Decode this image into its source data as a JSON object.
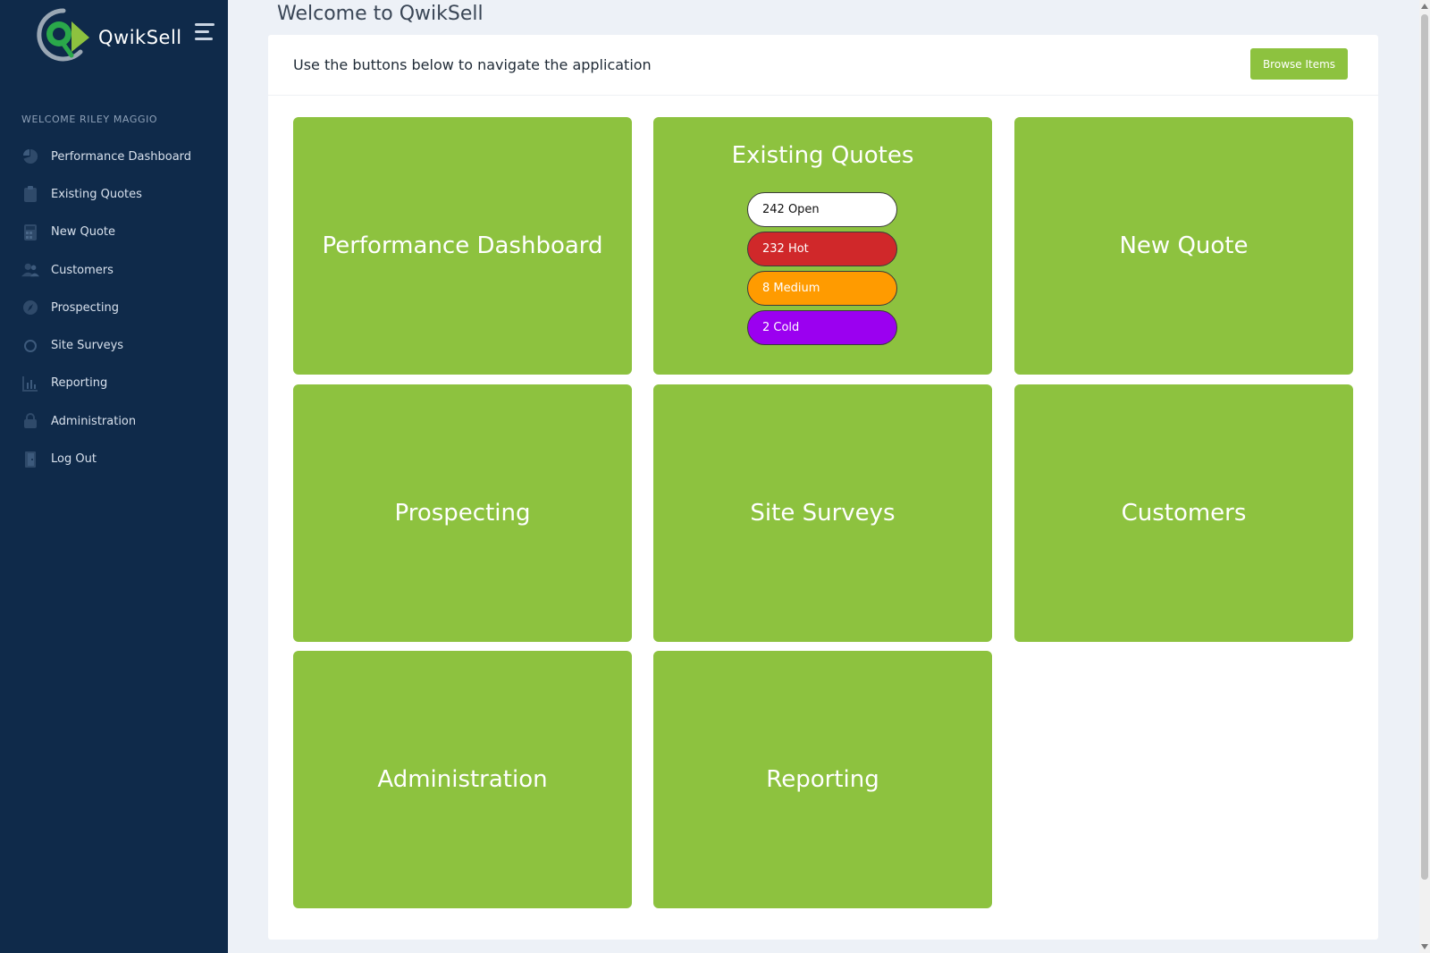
{
  "app": {
    "brand_name": "QwikSell",
    "page_title": "Welcome to QwikSell"
  },
  "sidebar": {
    "welcome_label": "WELCOME RILEY MAGGIO",
    "items": [
      {
        "label": "Performance Dashboard",
        "icon": "pie-chart-icon"
      },
      {
        "label": "Existing Quotes",
        "icon": "clipboard-icon"
      },
      {
        "label": "New Quote",
        "icon": "calculator-icon"
      },
      {
        "label": "Customers",
        "icon": "users-icon"
      },
      {
        "label": "Prospecting",
        "icon": "compass-icon"
      },
      {
        "label": "Site Surveys",
        "icon": "circle-icon"
      },
      {
        "label": "Reporting",
        "icon": "bar-chart-icon"
      },
      {
        "label": "Administration",
        "icon": "lock-icon"
      },
      {
        "label": "Log Out",
        "icon": "door-icon"
      }
    ]
  },
  "panel": {
    "instructions": "Use the buttons below to navigate the application",
    "browse_button": "Browse Items"
  },
  "tiles": {
    "performance_dashboard": "Performance Dashboard",
    "existing_quotes": "Existing Quotes",
    "new_quote": "New Quote",
    "prospecting": "Prospecting",
    "site_surveys": "Site Surveys",
    "customers": "Customers",
    "administration": "Administration",
    "reporting": "Reporting"
  },
  "quote_status": [
    {
      "label": "242 Open",
      "color": "#ffffff",
      "text_color": "#111111"
    },
    {
      "label": "232 Hot",
      "color": "#d0282a",
      "text_color": "#ffffff"
    },
    {
      "label": "8 Medium",
      "color": "#ff9b00",
      "text_color": "#ffffff"
    },
    {
      "label": "2 Cold",
      "color": "#9b00f0",
      "text_color": "#ffffff"
    }
  ],
  "colors": {
    "sidebar_bg": "#0f2a4a",
    "accent_green": "#8dc23f",
    "page_bg": "#edf1f7"
  }
}
